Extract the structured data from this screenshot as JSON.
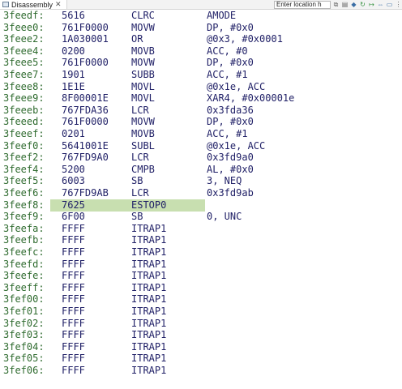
{
  "tab": {
    "label": "Disassembly",
    "close": "✕"
  },
  "toolbar": {
    "location_placeholder": "Enter location h"
  },
  "rows": [
    {
      "addr": "3feedf:",
      "hex": "5616",
      "mnemonic": "CLRC",
      "operands": "AMODE"
    },
    {
      "addr": "3feee0:",
      "hex": "761F0000",
      "mnemonic": "MOVW",
      "operands": "DP, #0x0"
    },
    {
      "addr": "3feee2:",
      "hex": "1A030001",
      "mnemonic": "OR",
      "operands": "@0x3, #0x0001"
    },
    {
      "addr": "3feee4:",
      "hex": "0200",
      "mnemonic": "MOVB",
      "operands": "ACC, #0"
    },
    {
      "addr": "3feee5:",
      "hex": "761F0000",
      "mnemonic": "MOVW",
      "operands": "DP, #0x0"
    },
    {
      "addr": "3feee7:",
      "hex": "1901",
      "mnemonic": "SUBB",
      "operands": "ACC, #1"
    },
    {
      "addr": "3feee8:",
      "hex": "1E1E",
      "mnemonic": "MOVL",
      "operands": "@0x1e, ACC"
    },
    {
      "addr": "3feee9:",
      "hex": "8F00001E",
      "mnemonic": "MOVL",
      "operands": "XAR4, #0x00001e"
    },
    {
      "addr": "3feeeb:",
      "hex": "767FDA36",
      "mnemonic": "LCR",
      "operands": "0x3fda36"
    },
    {
      "addr": "3feeed:",
      "hex": "761F0000",
      "mnemonic": "MOVW",
      "operands": "DP, #0x0"
    },
    {
      "addr": "3feeef:",
      "hex": "0201",
      "mnemonic": "MOVB",
      "operands": "ACC, #1"
    },
    {
      "addr": "3feef0:",
      "hex": "5641001E",
      "mnemonic": "SUBL",
      "operands": "@0x1e, ACC"
    },
    {
      "addr": "3feef2:",
      "hex": "767FD9A0",
      "mnemonic": "LCR",
      "operands": "0x3fd9a0"
    },
    {
      "addr": "3feef4:",
      "hex": "5200",
      "mnemonic": "CMPB",
      "operands": "AL, #0x0"
    },
    {
      "addr": "3feef5:",
      "hex": "6003",
      "mnemonic": "SB",
      "operands": "3, NEQ"
    },
    {
      "addr": "3feef6:",
      "hex": "767FD9AB",
      "mnemonic": "LCR",
      "operands": "0x3fd9ab"
    },
    {
      "addr": "3feef8:",
      "hex": "7625",
      "mnemonic": "ESTOP0",
      "operands": "",
      "highlighted": true
    },
    {
      "addr": "3feef9:",
      "hex": "6F00",
      "mnemonic": "SB",
      "operands": "0, UNC"
    },
    {
      "addr": "3feefa:",
      "hex": "FFFF",
      "mnemonic": "ITRAP1",
      "operands": ""
    },
    {
      "addr": "3feefb:",
      "hex": "FFFF",
      "mnemonic": "ITRAP1",
      "operands": ""
    },
    {
      "addr": "3feefc:",
      "hex": "FFFF",
      "mnemonic": "ITRAP1",
      "operands": ""
    },
    {
      "addr": "3feefd:",
      "hex": "FFFF",
      "mnemonic": "ITRAP1",
      "operands": ""
    },
    {
      "addr": "3feefe:",
      "hex": "FFFF",
      "mnemonic": "ITRAP1",
      "operands": ""
    },
    {
      "addr": "3feeff:",
      "hex": "FFFF",
      "mnemonic": "ITRAP1",
      "operands": ""
    },
    {
      "addr": "3fef00:",
      "hex": "FFFF",
      "mnemonic": "ITRAP1",
      "operands": ""
    },
    {
      "addr": "3fef01:",
      "hex": "FFFF",
      "mnemonic": "ITRAP1",
      "operands": ""
    },
    {
      "addr": "3fef02:",
      "hex": "FFFF",
      "mnemonic": "ITRAP1",
      "operands": ""
    },
    {
      "addr": "3fef03:",
      "hex": "FFFF",
      "mnemonic": "ITRAP1",
      "operands": ""
    },
    {
      "addr": "3fef04:",
      "hex": "FFFF",
      "mnemonic": "ITRAP1",
      "operands": ""
    },
    {
      "addr": "3fef05:",
      "hex": "FFFF",
      "mnemonic": "ITRAP1",
      "operands": ""
    },
    {
      "addr": "3fef06:",
      "hex": "FFFF",
      "mnemonic": "ITRAP1",
      "operands": ""
    }
  ]
}
